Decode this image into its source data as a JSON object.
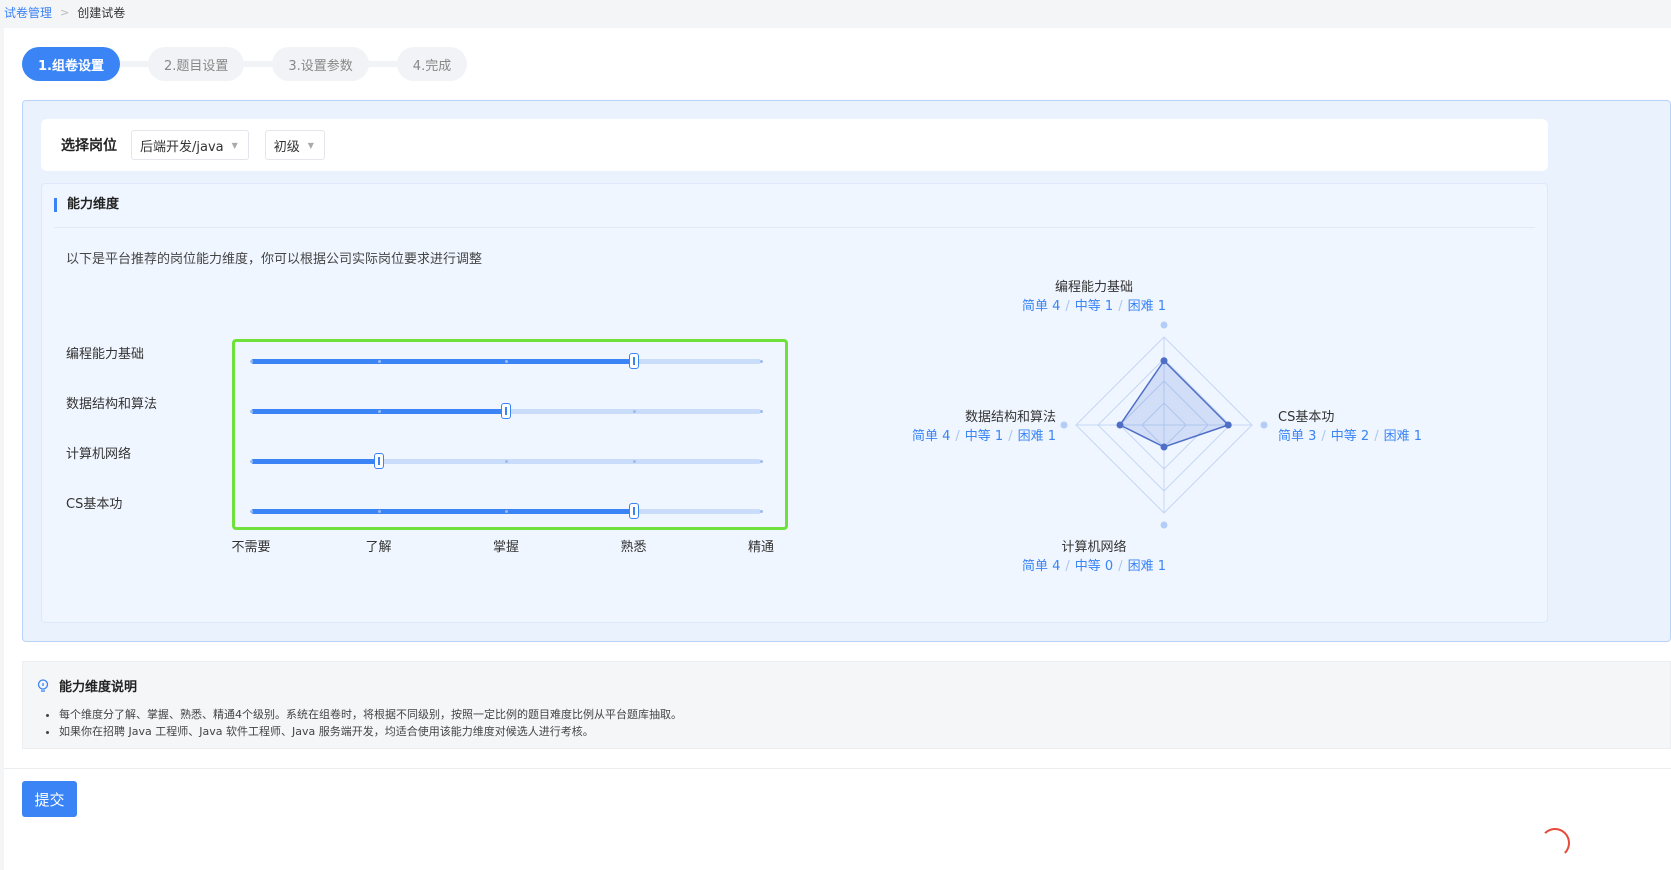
{
  "breadcrumb": {
    "parent": "试卷管理",
    "separator": ">",
    "current": "创建试卷"
  },
  "steps": [
    {
      "label": "1.组卷设置",
      "active": true
    },
    {
      "label": "2.题目设置",
      "active": false
    },
    {
      "label": "3.设置参数",
      "active": false
    },
    {
      "label": "4.完成",
      "active": false
    }
  ],
  "position": {
    "label": "选择岗位",
    "role_value": "后端开发/java",
    "level_value": "初级"
  },
  "ability": {
    "title": "能力维度",
    "description": "以下是平台推荐的岗位能力维度，你可以根据公司实际岗位要求进行调整",
    "levels": [
      "不需要",
      "了解",
      "掌握",
      "熟悉",
      "精通"
    ],
    "dimensions": [
      {
        "name": "编程能力基础",
        "level_index": 3
      },
      {
        "name": "数据结构和算法",
        "level_index": 2
      },
      {
        "name": "计算机网络",
        "level_index": 1
      },
      {
        "name": "CS基本功",
        "level_index": 3
      }
    ]
  },
  "radar": {
    "axes": [
      {
        "name": "编程能力基础",
        "easy": "简单 4",
        "medium": "中等 1",
        "hard": "困难 1",
        "value": 0.73
      },
      {
        "name": "CS基本功",
        "easy": "简单 3",
        "medium": "中等 2",
        "hard": "困难 1",
        "value": 0.73
      },
      {
        "name": "计算机网络",
        "easy": "简单 4",
        "medium": "中等 0",
        "hard": "困难 1",
        "value": 0.25
      },
      {
        "name": "数据结构和算法",
        "easy": "简单 4",
        "medium": "中等 1",
        "hard": "困难 1",
        "value": 0.5
      }
    ],
    "slash": "/"
  },
  "explanation": {
    "title": "能力维度说明",
    "items": [
      "每个维度分了解、掌握、熟悉、精通4个级别。系统在组卷时，将根据不同级别，按照一定比例的题目难度比例从平台题库抽取。",
      "如果你在招聘 Java 工程师、Java 软件工程师、Java 服务端开发，均适合使用该能力维度对候选人进行考核。"
    ]
  },
  "submit_label": "提交",
  "colors": {
    "accent": "#3a84f6",
    "highlight_border": "#6ee23a"
  }
}
